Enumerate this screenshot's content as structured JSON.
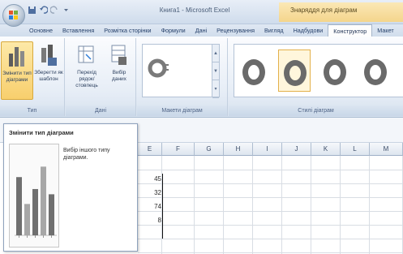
{
  "window": {
    "title": "Книга1 - Microsoft Excel",
    "context_tab_group": "Знаряддя для діаграм"
  },
  "tabs": [
    {
      "label": "Основне"
    },
    {
      "label": "Вставлення"
    },
    {
      "label": "Розмітка сторінки"
    },
    {
      "label": "Формули"
    },
    {
      "label": "Дані"
    },
    {
      "label": "Рецензування"
    },
    {
      "label": "Вигляд"
    },
    {
      "label": "Надбудови"
    },
    {
      "label": "Конструктор",
      "active": true
    },
    {
      "label": "Макет"
    }
  ],
  "ribbon": {
    "type_group": {
      "label": "Тип",
      "change_type": "Змінити тип діаграми",
      "save_template": "Зберегти як шаблон"
    },
    "data_group": {
      "label": "Дані",
      "switch_row_col": "Перехід рядок/стовпець",
      "select_data": "Вибір даних"
    },
    "layouts_group": {
      "label": "Макети діаграм"
    },
    "styles_group": {
      "label": "Стилі діаграм"
    }
  },
  "sheet": {
    "columns": [
      "E",
      "F",
      "G",
      "H",
      "I",
      "J",
      "K",
      "L",
      "M"
    ],
    "values": [
      "45",
      "32",
      "74",
      "8"
    ]
  },
  "tooltip": {
    "title": "Змінити тип діаграми",
    "description": "Вибір іншого типу діаграми.",
    "preview_bars": [
      0.78,
      0.42,
      0.62,
      0.92,
      0.55
    ]
  },
  "colors": {
    "ribbon_bg": "#e6edf6",
    "accent": "#f8cf6d",
    "bar_dark": "#6f6f6f",
    "bar_light": "#a7a7a7"
  }
}
